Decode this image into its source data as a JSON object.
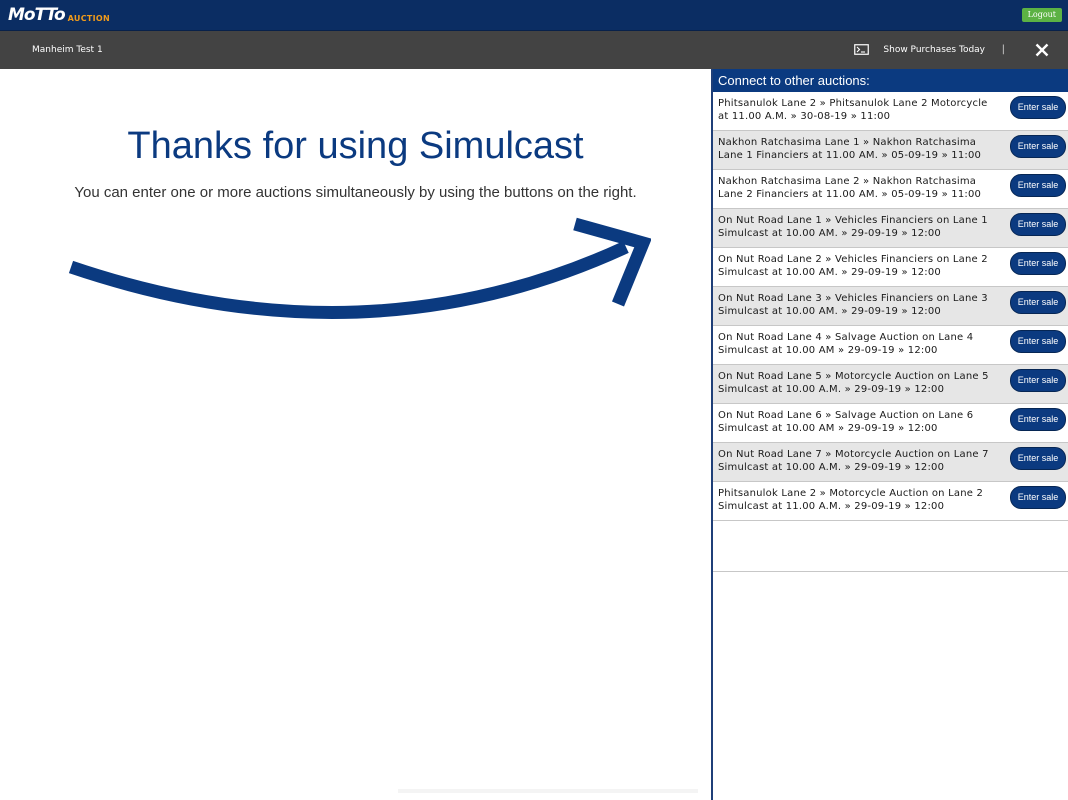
{
  "brand": {
    "logo_main": "MoTTo",
    "logo_sub": "AUCTION",
    "colors": {
      "primary": "#0b3a80",
      "accent": "#f29b1a",
      "logout": "#5cb244"
    }
  },
  "header": {
    "logout_label": "Logout",
    "account_name": "Manheim Test 1",
    "purchases_label": "Show Purchases Today",
    "separator": "|",
    "purchases_icon": "screen-icon",
    "close_icon": "close-icon"
  },
  "main": {
    "headline": "Thanks for using Simulcast",
    "subline": "You can enter one or more auctions simultaneously by using the buttons on the right.",
    "arrow_icon": "curved-arrow-right-icon"
  },
  "panel": {
    "title": "Connect to other auctions:",
    "enter_label": "Enter sale",
    "sales": [
      {
        "line1": "Phitsanulok Lane 2 » Phitsanulok Lane 2 Motorcycle",
        "line2": "at 11.00 A.M. » 30-08-19 » 11:00"
      },
      {
        "line1": "Nakhon Ratchasima Lane 1 » Nakhon Ratchasima",
        "line2": "Lane 1 Financiers at 11.00 AM. » 05-09-19 » 11:00"
      },
      {
        "line1": "Nakhon Ratchasima Lane 2 » Nakhon Ratchasima",
        "line2": "Lane 2 Financiers at 11.00 AM. » 05-09-19 » 11:00"
      },
      {
        "line1": "On Nut Road Lane 1 » Vehicles Financiers on Lane 1",
        "line2": "Simulcast at 10.00 AM. » 29-09-19 » 12:00"
      },
      {
        "line1": "On Nut Road Lane 2 » Vehicles Financiers on Lane 2",
        "line2": "Simulcast at 10.00 AM. » 29-09-19 » 12:00"
      },
      {
        "line1": "On Nut Road Lane 3 » Vehicles Financiers on Lane 3",
        "line2": "Simulcast at 10.00 AM. » 29-09-19 » 12:00"
      },
      {
        "line1": "On Nut Road Lane 4 » Salvage Auction on Lane 4",
        "line2": "Simulcast at 10.00 AM » 29-09-19 » 12:00"
      },
      {
        "line1": "On Nut Road Lane 5 » Motorcycle Auction on Lane 5",
        "line2": "Simulcast at 10.00 A.M. » 29-09-19 » 12:00"
      },
      {
        "line1": "On Nut Road Lane 6 » Salvage Auction on Lane 6",
        "line2": "Simulcast at 10.00 AM » 29-09-19 » 12:00"
      },
      {
        "line1": "On Nut Road Lane 7 » Motorcycle Auction on Lane 7",
        "line2": "Simulcast at 10.00 A.M. » 29-09-19 » 12:00"
      },
      {
        "line1": "Phitsanulok Lane 2 » Motorcycle Auction on Lane 2",
        "line2": "Simulcast at 11.00 A.M. » 29-09-19 » 12:00"
      }
    ]
  }
}
